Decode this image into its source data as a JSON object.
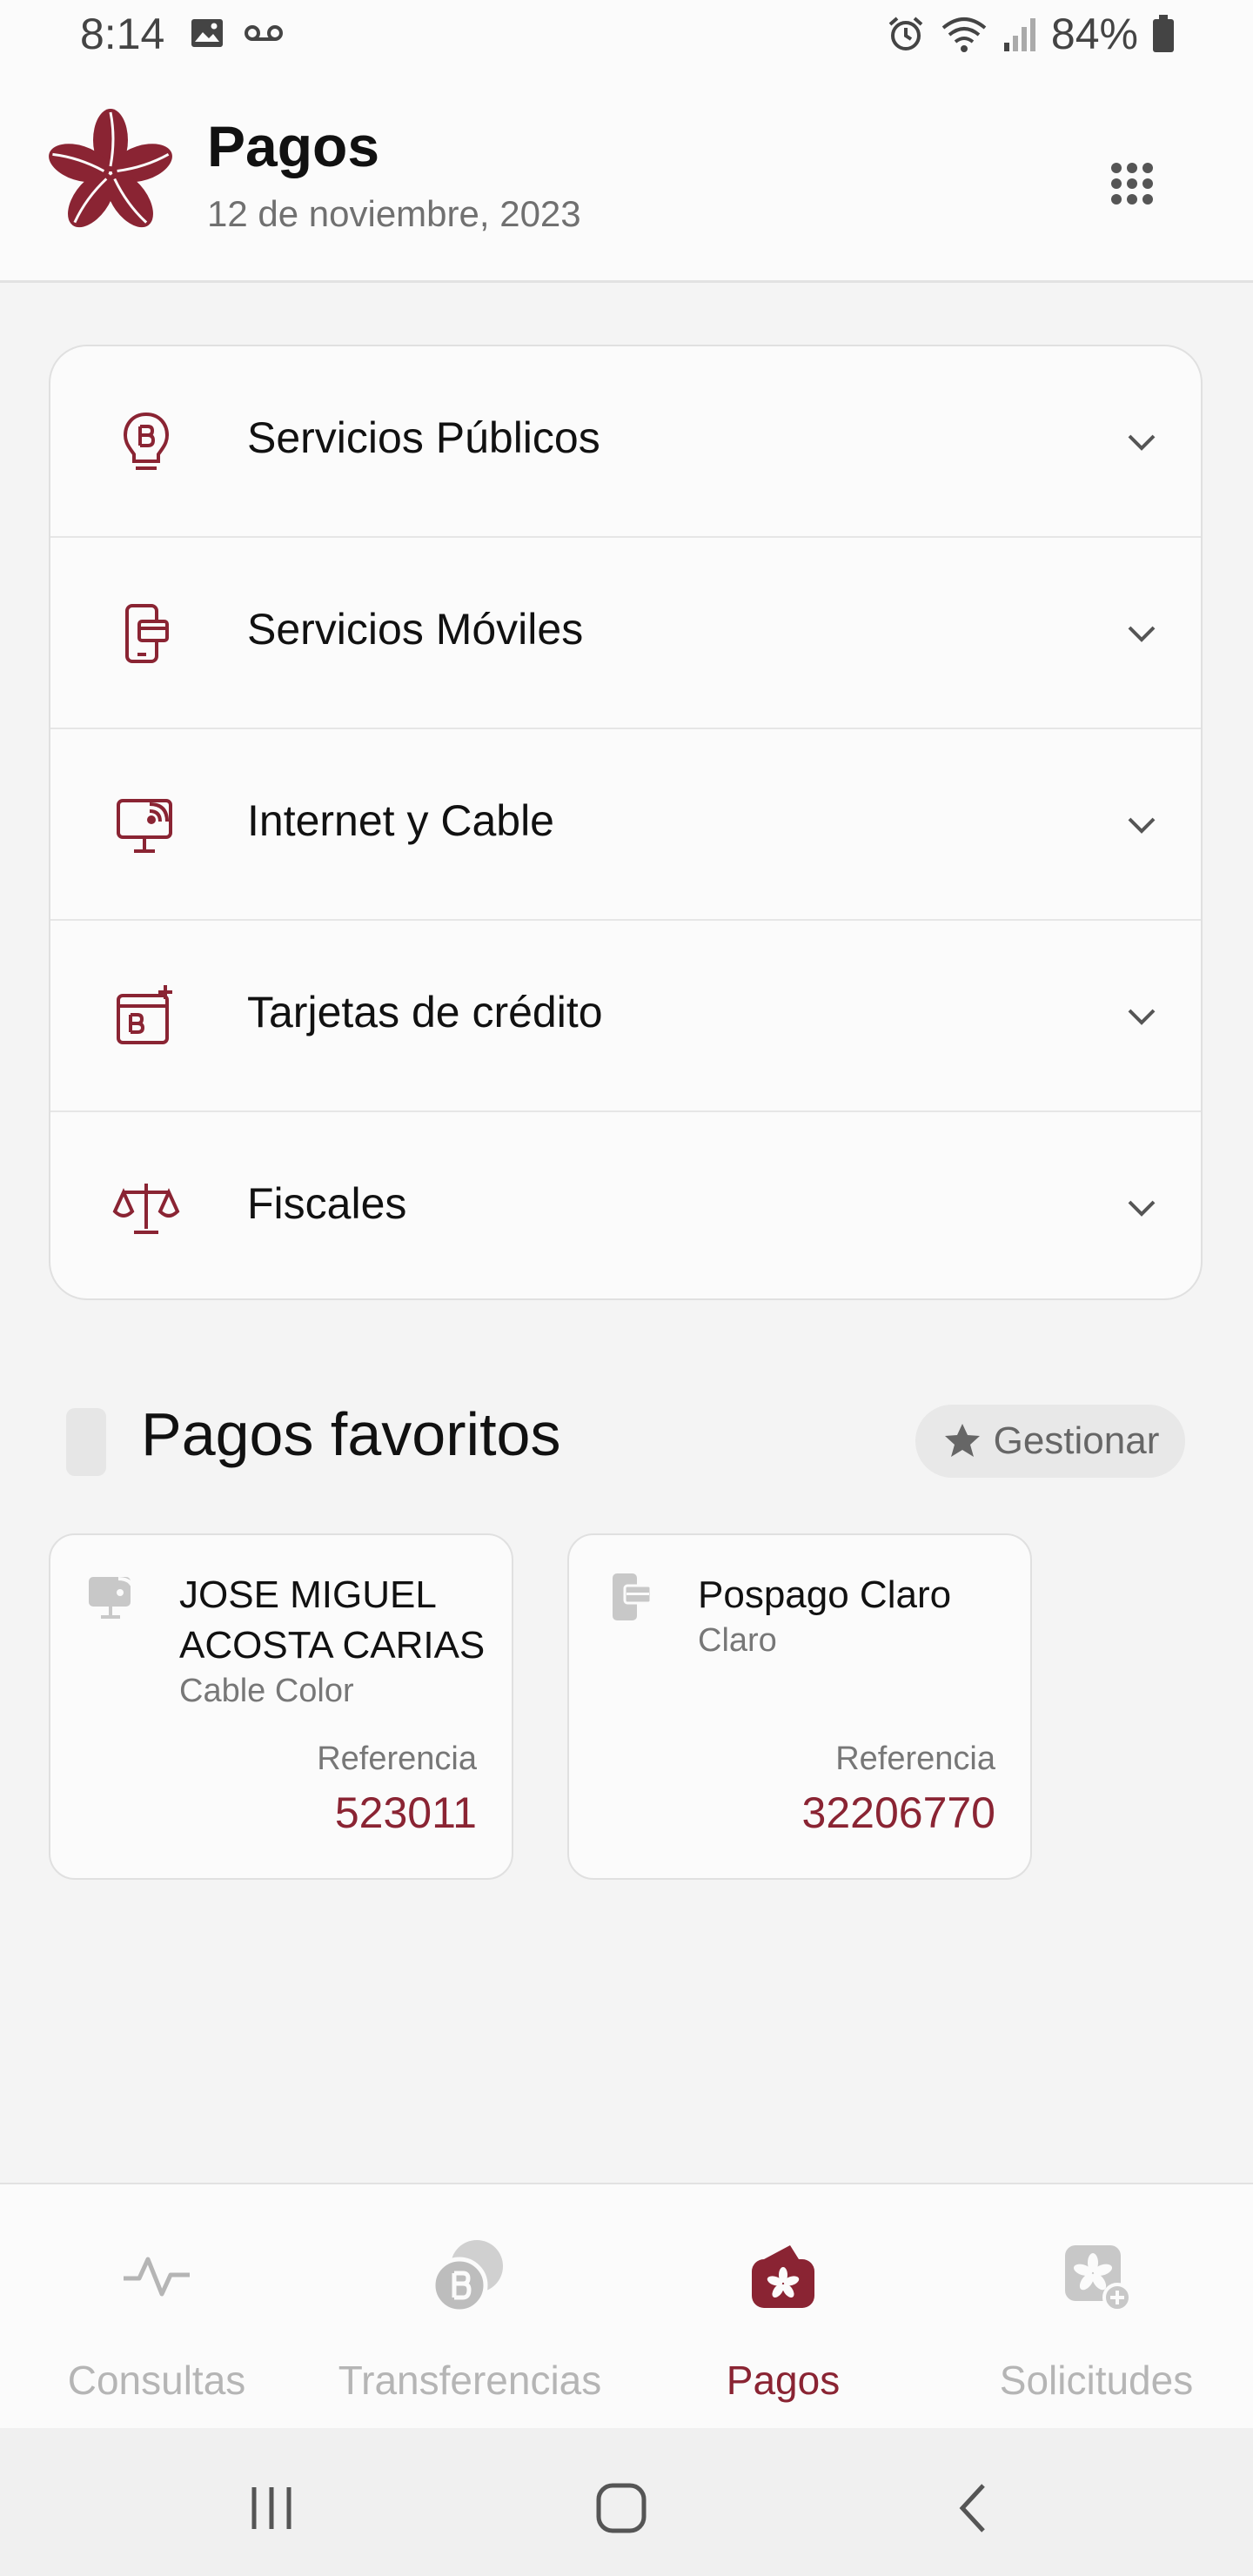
{
  "status_bar": {
    "time": "8:14",
    "battery": "84%"
  },
  "header": {
    "title": "Pagos",
    "date": "12 de noviembre, 2023"
  },
  "categories": [
    {
      "label": "Servicios Públicos",
      "icon": "bulb-bill-icon"
    },
    {
      "label": "Servicios Móviles",
      "icon": "phone-card-icon"
    },
    {
      "label": "Internet y Cable",
      "icon": "monitor-signal-icon"
    },
    {
      "label": "Tarjetas de crédito",
      "icon": "card-add-icon"
    },
    {
      "label": "Fiscales",
      "icon": "scale-icon"
    }
  ],
  "favorites": {
    "title": "Pagos favoritos",
    "manage_label": "Gestionar",
    "items": [
      {
        "name": "JOSE MIGUEL ACOSTA CARIAS",
        "provider": "Cable Color",
        "reference_label": "Referencia",
        "reference": "523011",
        "icon": "monitor-signal-icon"
      },
      {
        "name": "Pospago Claro",
        "provider": "Claro",
        "reference_label": "Referencia",
        "reference": "32206770",
        "icon": "phone-card-icon"
      }
    ]
  },
  "bottom_nav": [
    {
      "label": "Consultas",
      "icon": "pulse-icon",
      "active": false
    },
    {
      "label": "Transferencias",
      "icon": "transfer-icon",
      "active": false
    },
    {
      "label": "Pagos",
      "icon": "wallet-icon",
      "active": true
    },
    {
      "label": "Solicitudes",
      "icon": "request-icon",
      "active": false
    }
  ],
  "colors": {
    "brand": "#8a2433",
    "inactive": "#b5b5b5",
    "background": "#f4f4f4"
  }
}
